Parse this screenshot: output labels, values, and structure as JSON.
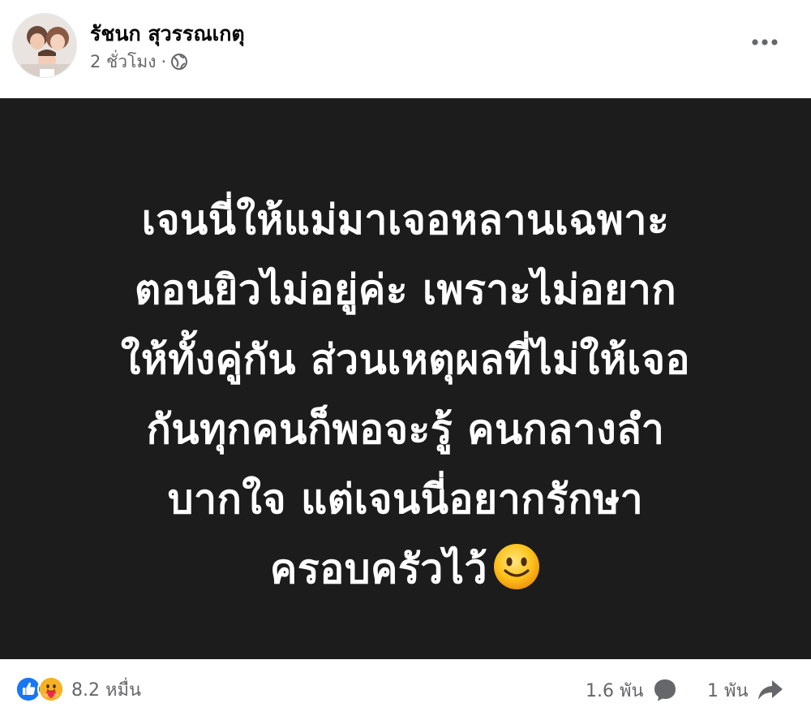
{
  "post": {
    "author": "รัชนก สุวรรณเกตุ",
    "time": "2 ชั่วโมง",
    "separator": "·",
    "privacy_icon": "globe-icon",
    "more_icon": "more-dots-icon"
  },
  "image": {
    "background": "#1c1c1c",
    "lines": [
      "เจนนี่ให้แม่มาเจอหลานเฉพาะ",
      "ตอนยิวไม่อยู่ค่ะ เพราะไม่อยาก",
      "ให้ทั้งคู่กัน ส่วนเหตุผลที่ไม่ให้เจอ",
      "กันทุกคนก็พอจะรู้ คนกลางลำ",
      "บากใจ แต่เจนนี่อยากรักษา",
      "ครอบครัวไว้"
    ],
    "emoji": "slightly-smiling-face-icon"
  },
  "footer": {
    "reaction_icons": [
      "like-icon",
      "care-icon"
    ],
    "reaction_count": "8.2 หมื่น",
    "comments": "1.6 พัน",
    "comment_icon": "comment-bubble-icon",
    "shares": "1 พัน",
    "share_icon": "share-arrow-icon",
    "colors": {
      "like": "#1877f2",
      "muted": "#65676b"
    }
  }
}
